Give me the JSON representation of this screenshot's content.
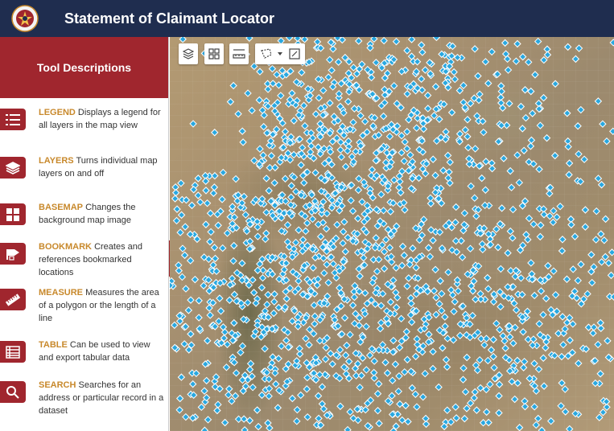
{
  "app": {
    "title": "Statement of Claimant Locator"
  },
  "panel": {
    "title": "Tool Descriptions",
    "tools": [
      {
        "name": "LEGEND",
        "desc": "Displays a legend for all layers in the map view",
        "icon": "legend-list-icon"
      },
      {
        "name": "LAYERS",
        "desc": "Turns individual map layers on and off",
        "icon": "layers-icon"
      },
      {
        "name": "BASEMAP",
        "desc": "Changes the background map image",
        "icon": "basemap-grid-icon"
      },
      {
        "name": "BOOKMARK",
        "desc": "Creates and references bookmarked locations",
        "icon": "bookmark-icon"
      },
      {
        "name": "MEASURE",
        "desc": "Measures the area of a polygon or the length of a line",
        "icon": "ruler-icon"
      },
      {
        "name": "TABLE",
        "desc": "Can be used to view and export tabular data",
        "icon": "table-icon"
      },
      {
        "name": "SEARCH",
        "desc": "Searches for an address or particular record in a dataset",
        "icon": "search-icon"
      }
    ]
  },
  "map_toolbar": {
    "buttons": [
      "layers-icon",
      "qr-grid-icon",
      "measure-icon",
      "select-tool-icon",
      "chevron-down-icon",
      "clear-selection-icon"
    ]
  },
  "colors": {
    "header": "#1f2d4f",
    "accent": "#a0262e",
    "tool_name": "#c8892c",
    "point_fill": "#29a8e0",
    "point_stroke": "#ffffff"
  }
}
